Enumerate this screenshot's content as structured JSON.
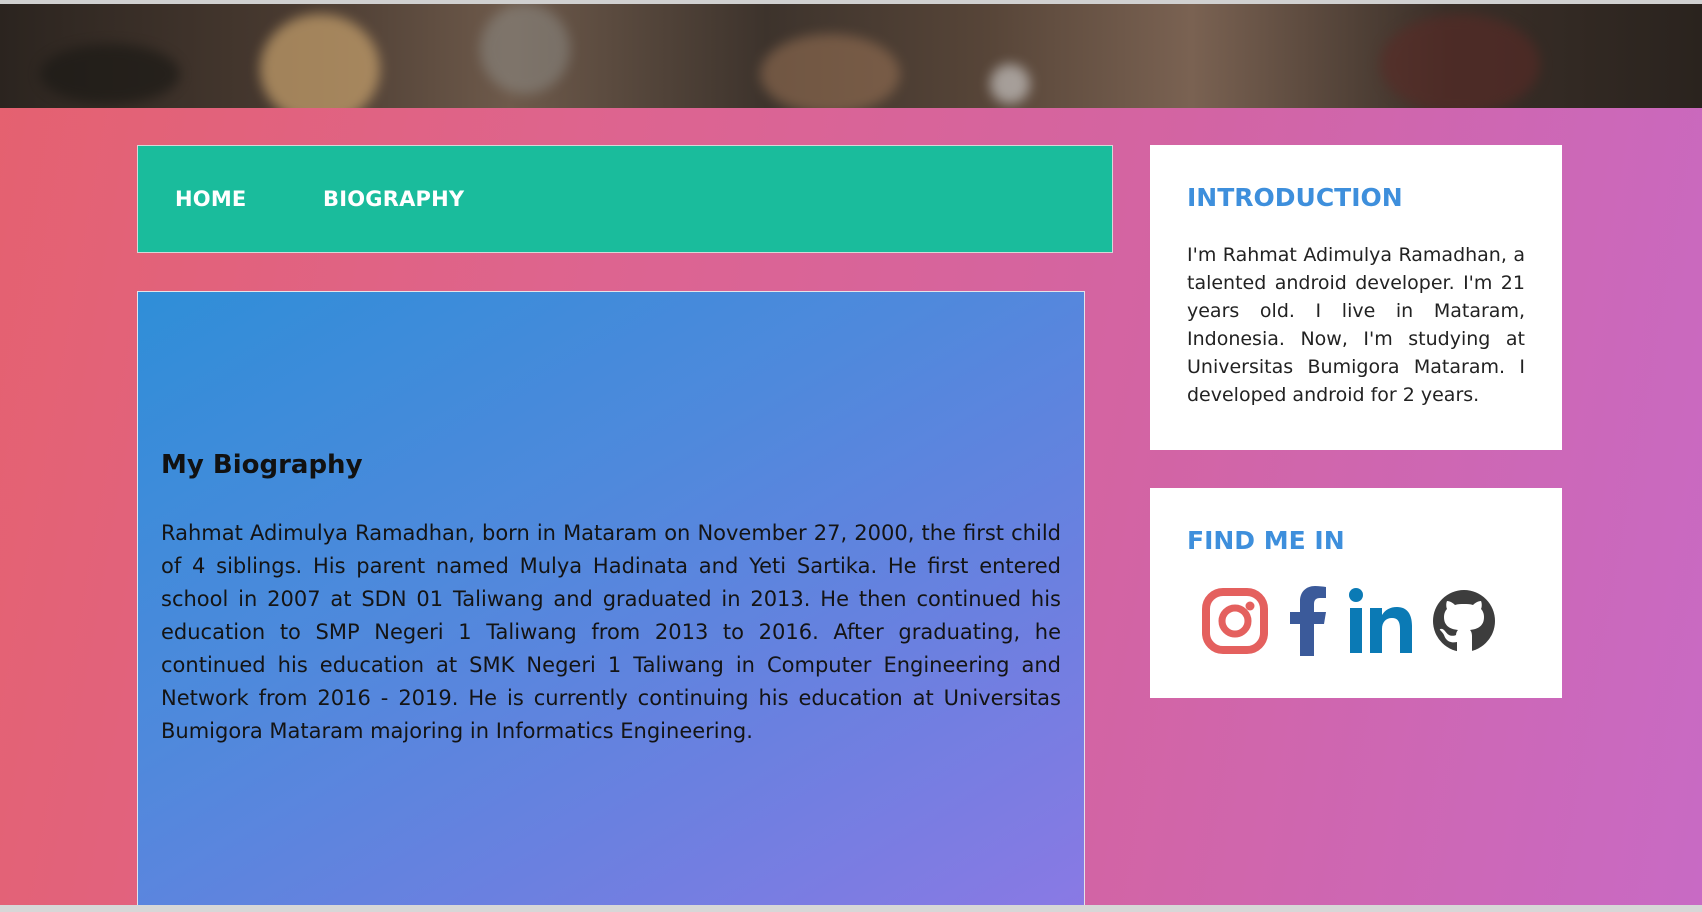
{
  "nav": {
    "home_label": "HOME",
    "biography_label": "BIOGRAPHY"
  },
  "biography": {
    "title": "My Biography",
    "text": "Rahmat Adimulya Ramadhan, born in Mataram on November 27, 2000, the first child of 4 siblings. His parent named Mulya Hadinata and Yeti Sartika. He first entered school in 2007 at SDN 01 Taliwang and graduated in 2013. He then continued his education to SMP Negeri 1 Taliwang from 2013 to 2016. After graduating, he continued his education at SMK Negeri 1 Taliwang in Computer Engineering and Network from 2016 - 2019. He is currently continuing his education at Universitas Bumigora Mataram majoring in Informatics Engineering."
  },
  "introduction": {
    "title": "INTRODUCTION",
    "text": "I'm Rahmat Adimulya Ramadhan, a talented android developer. I'm 21 years old. I live in Mataram, Indonesia. Now, I'm studying at Universitas Bumigora Mataram. I developed android for 2 years."
  },
  "find_me": {
    "title": "FIND ME IN",
    "icons": [
      "instagram-icon",
      "facebook-icon",
      "linkedin-icon",
      "github-icon"
    ]
  },
  "colors": {
    "navbar": "#1abc9c",
    "accent_title": "#3e8fdc",
    "instagram": "#e4605e",
    "facebook": "#3b5a9a",
    "linkedin": "#0b7ab5",
    "github": "#3d3d3d"
  }
}
